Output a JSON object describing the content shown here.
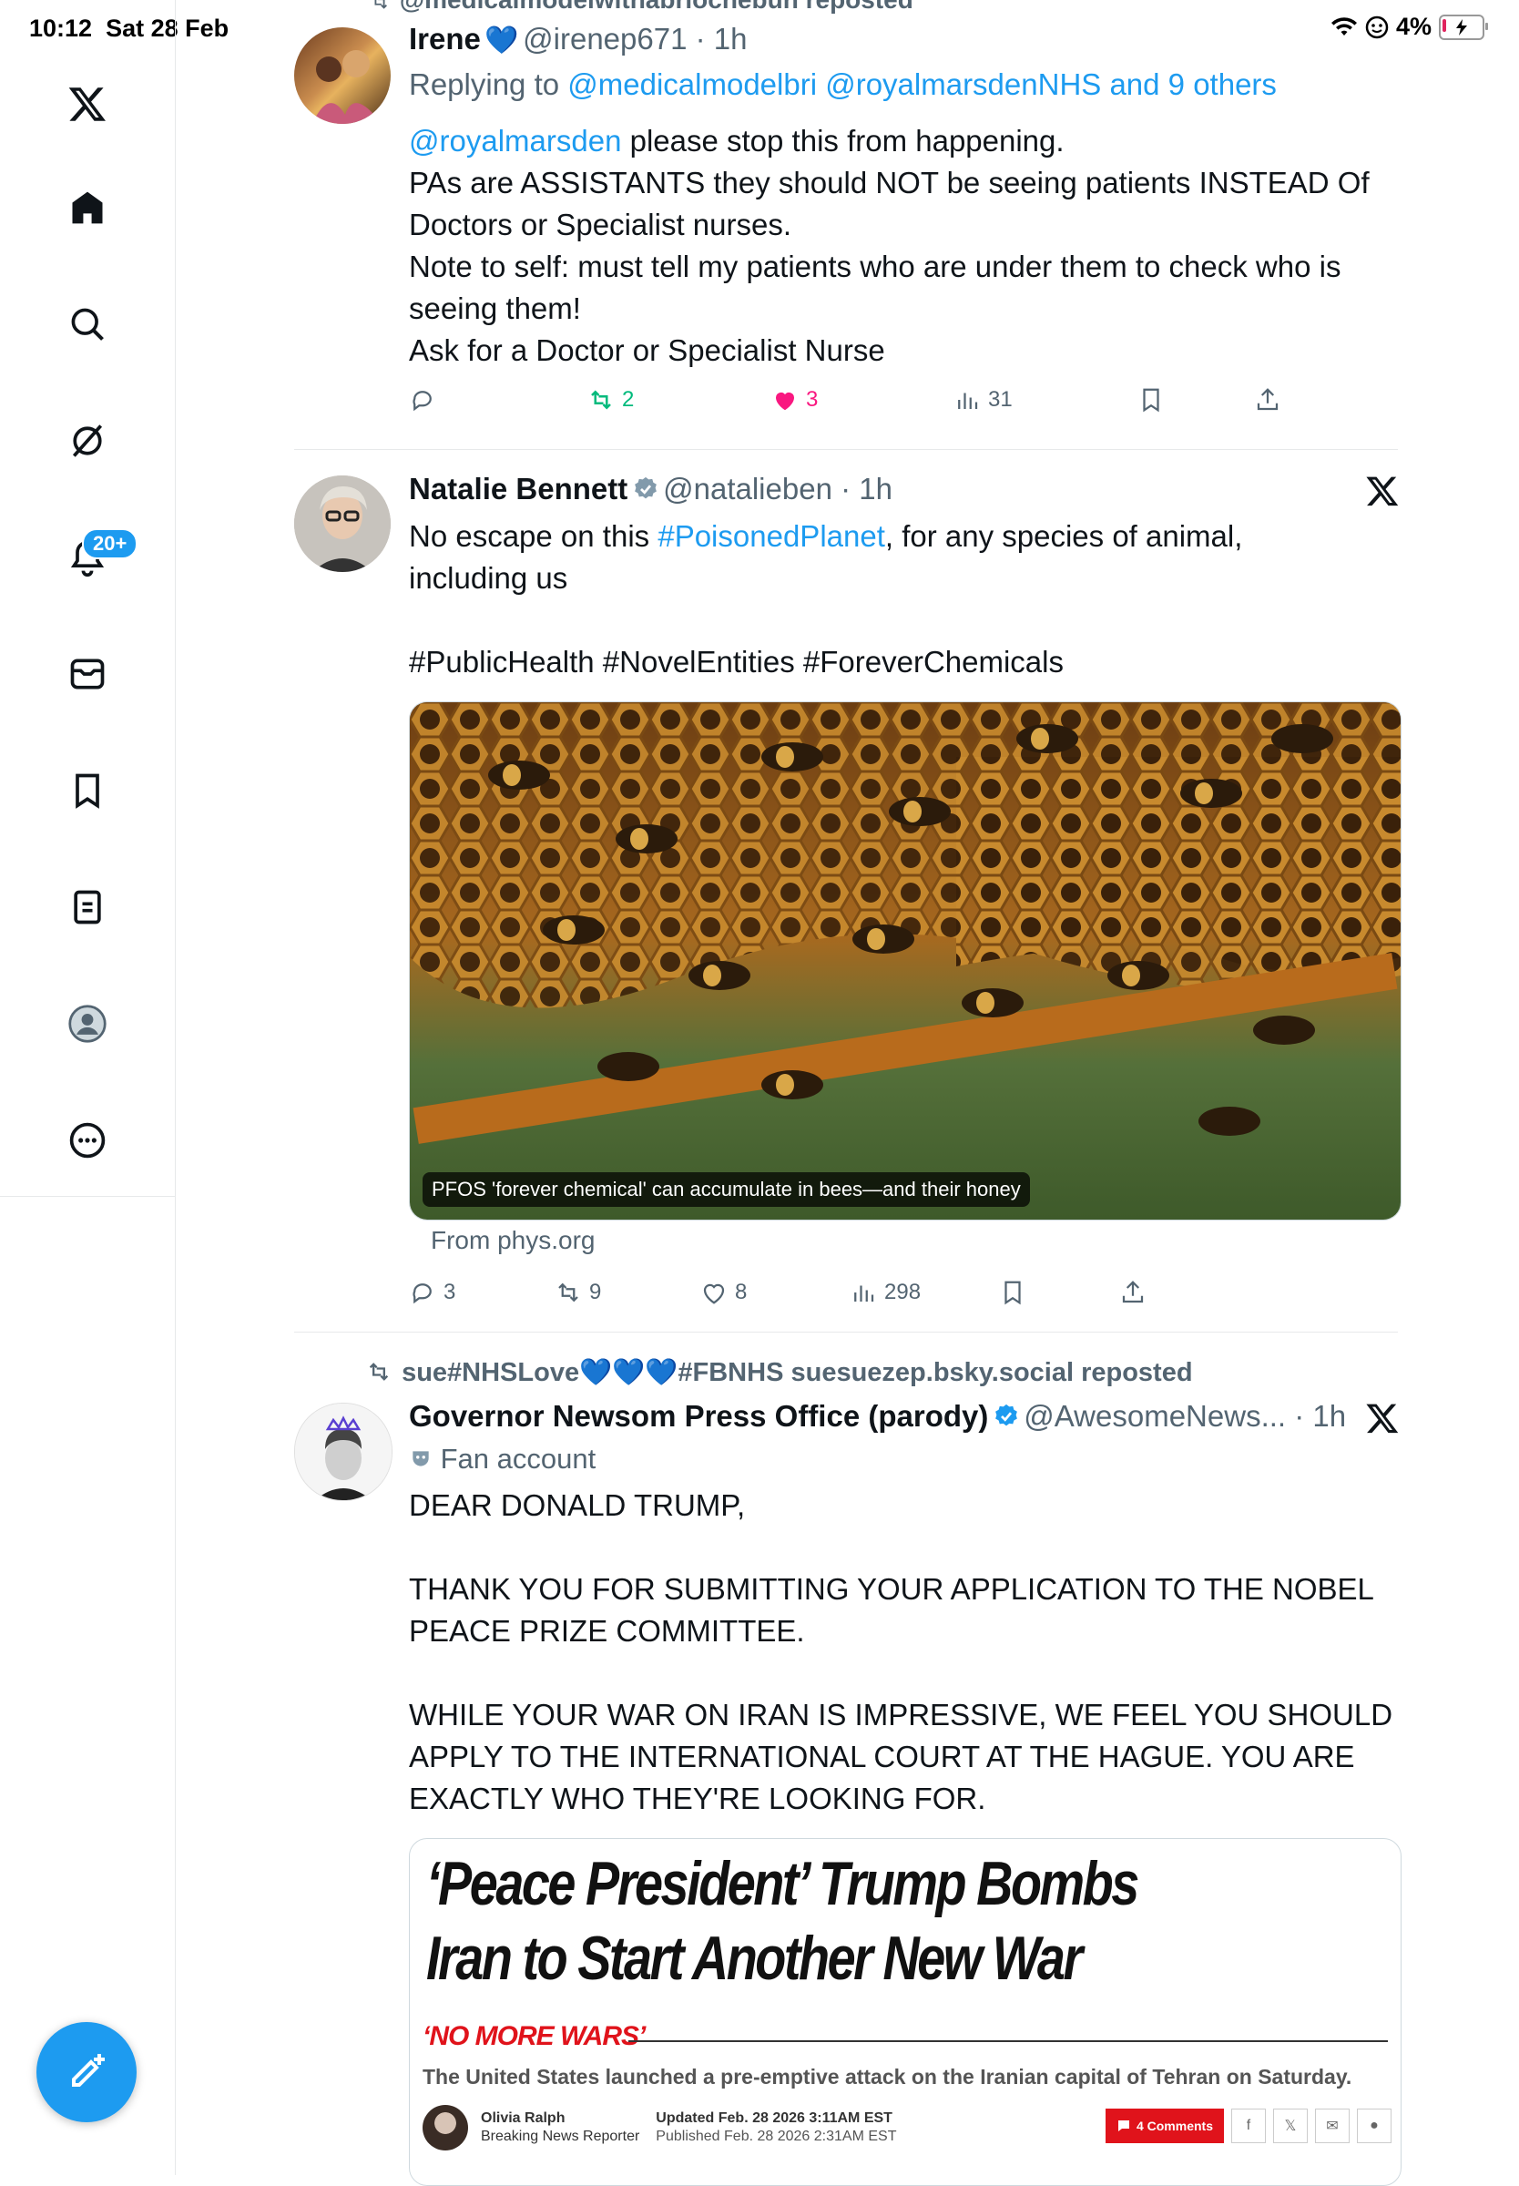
{
  "status": {
    "time": "10:12",
    "date": "Sat 28 Feb",
    "battery": "4%"
  },
  "sidebar": {
    "notif_badge": "20+"
  },
  "tweet1": {
    "repost_line": "@medicalmodelwithabriochebun reposted",
    "name": "Irene",
    "emoji": "💙",
    "handle": "@irenep671",
    "time": "1h",
    "replying_prefix": "Replying to ",
    "replying_to": "@medicalmodelbri @royalmarsdenNHS and 9 others",
    "mention": "@royalmarsden",
    "text_after_mention": " please stop this from happening.",
    "text_rest": "PAs are ASSISTANTS they should NOT be seeing patients INSTEAD Of Doctors or Specialist nurses.\nNote to self: must tell my patients who are under them to check who is seeing them!\nAsk for a Doctor or Specialist Nurse",
    "reposts": "2",
    "likes": "3",
    "views": "31"
  },
  "tweet2": {
    "name": "Natalie Bennett",
    "handle": "@natalieben",
    "time": "1h",
    "text_prefix": "No escape on this ",
    "hashtag_inline": "#PoisonedPlanet",
    "text_suffix": ", for any species of animal, including us",
    "hashtags": "#PublicHealth #NovelEntities #ForeverChemicals",
    "image_caption": "PFOS 'forever chemical' can accumulate in bees—and their honey",
    "from": "From phys.org",
    "replies": "3",
    "reposts": "9",
    "likes": "8",
    "views": "298"
  },
  "tweet3": {
    "repost_line": "sue#NHSLove💙💙💙#FBNHS suesuezep.bsky.social reposted",
    "name": "Governor Newsom Press Office (parody)",
    "handle": "@AwesomeNews...",
    "time": "1h",
    "fan_label": "Fan account",
    "text": "DEAR DONALD TRUMP,\n\nTHANK YOU FOR SUBMITTING YOUR APPLICATION TO THE NOBEL PEACE PRIZE COMMITTEE.\n\nWHILE YOUR WAR ON IRAN IS IMPRESSIVE, WE FEEL YOU SHOULD APPLY TO THE INTERNATIONAL COURT AT THE HAGUE. YOU ARE EXACTLY WHO THEY'RE LOOKING FOR.",
    "article": {
      "headline": "‘Peace President’ Trump Bombs Iran to Start Another New War",
      "kicker": "‘NO MORE WARS’",
      "subhead": "The United States launched a pre-emptive attack on the Iranian capital of Tehran on Saturday.",
      "author": "Olivia Ralph",
      "author_role": "Breaking News Reporter",
      "updated": "Updated Feb. 28 2026 3:11AM EST",
      "published": "Published Feb. 28 2026 2:31AM EST",
      "comments": "4 Comments"
    }
  },
  "colors": {
    "accent": "#1d9bf0",
    "retweet": "#00ba7c",
    "like": "#f91880"
  }
}
